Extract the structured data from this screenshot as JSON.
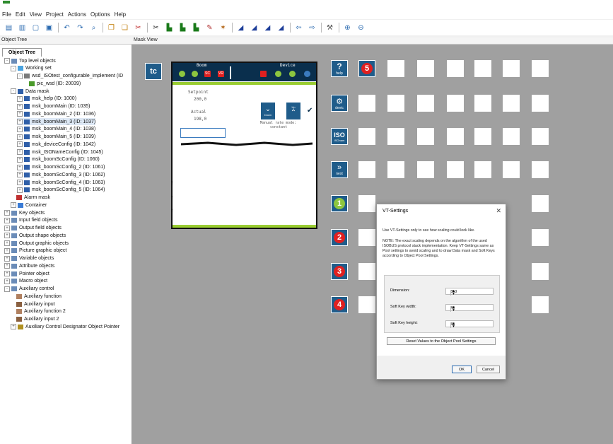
{
  "menu": [
    "File",
    "Edit",
    "View",
    "Project",
    "Actions",
    "Options",
    "Help"
  ],
  "panes": {
    "object_tree": "Object Tree",
    "mask_view": "Mask View"
  },
  "tree": {
    "tab": "Object Tree",
    "items": [
      {
        "label": "Top level objects",
        "depth": 0,
        "exp": "-",
        "icon": "folder-icon"
      },
      {
        "label": "Working set",
        "depth": 1,
        "exp": "-",
        "icon": "working-set-icon"
      },
      {
        "label": "wsd_ISOtest_configurable_implement (ID",
        "depth": 2,
        "exp": "-",
        "icon": "object-icon"
      },
      {
        "label": "pic_wsd (ID: 20039)",
        "depth": 3,
        "exp": "",
        "icon": "picture-icon"
      },
      {
        "label": "Data mask",
        "depth": 1,
        "exp": "-",
        "icon": "data-mask-icon"
      },
      {
        "label": "msk_help (ID: 1000)",
        "depth": 2,
        "exp": "+",
        "icon": "mask-icon"
      },
      {
        "label": "msk_boomMain (ID: 1035)",
        "depth": 2,
        "exp": "+",
        "icon": "mask-icon"
      },
      {
        "label": "msk_boomMain_2 (ID: 1036)",
        "depth": 2,
        "exp": "+",
        "icon": "mask-icon"
      },
      {
        "label": "msk_boomMain_3 (ID: 1037)",
        "depth": 2,
        "exp": "+",
        "icon": "mask-icon",
        "selected": true
      },
      {
        "label": "msk_boomMain_4 (ID: 1038)",
        "depth": 2,
        "exp": "+",
        "icon": "mask-icon"
      },
      {
        "label": "msk_boomMain_5 (ID: 1039)",
        "depth": 2,
        "exp": "+",
        "icon": "mask-icon"
      },
      {
        "label": "msk_deviceConfig (ID: 1042)",
        "depth": 2,
        "exp": "+",
        "icon": "mask-icon"
      },
      {
        "label": "msk_ISONameConfig (ID: 1045)",
        "depth": 2,
        "exp": "+",
        "icon": "mask-icon"
      },
      {
        "label": "msk_boomScConfig (ID: 1060)",
        "depth": 2,
        "exp": "+",
        "icon": "mask-icon"
      },
      {
        "label": "msk_boomScConfig_2 (ID: 1061)",
        "depth": 2,
        "exp": "+",
        "icon": "mask-icon"
      },
      {
        "label": "msk_boomScConfig_3 (ID: 1062)",
        "depth": 2,
        "exp": "+",
        "icon": "mask-icon"
      },
      {
        "label": "msk_boomScConfig_4 (ID: 1063)",
        "depth": 2,
        "exp": "+",
        "icon": "mask-icon"
      },
      {
        "label": "msk_boomScConfig_5 (ID: 1064)",
        "depth": 2,
        "exp": "+",
        "icon": "mask-icon"
      },
      {
        "label": "Alarm mask",
        "depth": 1,
        "exp": "",
        "icon": "alarm-mask-icon"
      },
      {
        "label": "Container",
        "depth": 1,
        "exp": "+",
        "icon": "container-icon"
      },
      {
        "label": "Key objects",
        "depth": 0,
        "exp": "+",
        "icon": "folder-icon"
      },
      {
        "label": "Input field objects",
        "depth": 0,
        "exp": "+",
        "icon": "folder-icon"
      },
      {
        "label": "Output field objects",
        "depth": 0,
        "exp": "+",
        "icon": "folder-icon"
      },
      {
        "label": "Output shape objects",
        "depth": 0,
        "exp": "+",
        "icon": "folder-icon"
      },
      {
        "label": "Output graphic objects",
        "depth": 0,
        "exp": "+",
        "icon": "folder-icon"
      },
      {
        "label": "Picture graphic object",
        "depth": 0,
        "exp": "+",
        "icon": "folder-icon"
      },
      {
        "label": "Variable objects",
        "depth": 0,
        "exp": "+",
        "icon": "folder-icon"
      },
      {
        "label": "Attribute objects",
        "depth": 0,
        "exp": "+",
        "icon": "folder-icon"
      },
      {
        "label": "Pointer object",
        "depth": 0,
        "exp": "+",
        "icon": "folder-icon"
      },
      {
        "label": "Macro object",
        "depth": 0,
        "exp": "+",
        "icon": "folder-icon"
      },
      {
        "label": "Auxiliary control",
        "depth": 0,
        "exp": "-",
        "icon": "folder-icon"
      },
      {
        "label": "Auxiliary function",
        "depth": 1,
        "exp": "",
        "icon": "aux-function-icon"
      },
      {
        "label": "Auxiliary input",
        "depth": 1,
        "exp": "",
        "icon": "aux-input-icon"
      },
      {
        "label": "Auxiliary function 2",
        "depth": 1,
        "exp": "",
        "icon": "aux-function-icon"
      },
      {
        "label": "Auxiliary input 2",
        "depth": 1,
        "exp": "",
        "icon": "aux-input-icon"
      },
      {
        "label": "Auxiliary Control Designator Object Pointer",
        "depth": 1,
        "exp": "+",
        "icon": "aux-pointer-icon"
      }
    ]
  },
  "mask": {
    "tc_label": "tc",
    "boom_label": "Boom",
    "device_label": "Device",
    "sc_label": "SC",
    "vr_label": "VR",
    "setpoint_label": "Setpoint",
    "setpoint_value": "200,0",
    "actual_label": "Actual",
    "actual_value": "198,0",
    "down_label": "Down",
    "up_label": "Up",
    "rate_mode_line1": "Manual rate mode:",
    "rate_mode_line2": "constant"
  },
  "softkeys": {
    "help": "help",
    "devic": "devic",
    "iso": "ISO",
    "isonam": "ISOnam",
    "next": "next",
    "five": "5",
    "one": "1",
    "two": "2",
    "three": "3",
    "four": "4"
  },
  "dialog": {
    "title": "VT-Settings",
    "close": "✕",
    "line1": "Use VT-Settings only to see how scaling could look like.",
    "note": "NOTE: The exact scaling depends on the algorithm of the used ISOBUS protocol stack implementation. Keep VT-Settings same as Pool settings to avoid scaling and to draw Data mask and Soft Keys according to Object Pool Settings.",
    "dimension_label": "Dimension:",
    "dimension_value": "350",
    "sk_width_label": "Soft Key width:",
    "sk_width_value": "40",
    "sk_height_label": "Soft Key height:",
    "sk_height_value": "40",
    "reset_label": "Reset Values to the Object Pool Settings",
    "ok_label": "OK",
    "cancel_label": "Cancel"
  },
  "colors": {
    "mask_blue": "#1f5c8a",
    "mask_header": "#0a2f4d",
    "alarm_red": "#e02020",
    "accent_green": "#9acd32",
    "view_gray": "#a0a0a0"
  }
}
